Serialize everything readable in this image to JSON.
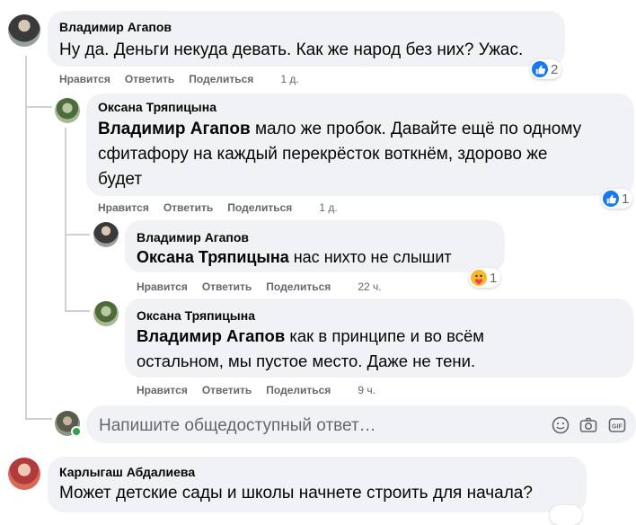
{
  "comments": [
    {
      "author": "Владимир Агапов",
      "mention": "",
      "text": "Ну да. Деньги некуда девать. Как же народ без них? Ужас.",
      "actions": {
        "like": "Нравится",
        "reply": "Ответить",
        "share": "Поделиться",
        "time": "1 д."
      },
      "reaction_count": "2"
    },
    {
      "author": "Оксана Тряпицына",
      "mention": "Владимир Агапов",
      "text_line1": " мало же пробок. Давайте ещё по одному",
      "text_line2": "сфитафору на каждый перекрёсток воткнём, здорово же",
      "text_line3": "будет",
      "actions": {
        "like": "Нравится",
        "reply": "Ответить",
        "share": "Поделиться",
        "time": "1 д."
      },
      "reaction_count": "1"
    },
    {
      "author": "Владимир Агапов",
      "mention": "Оксана Тряпицына",
      "text": " нас нихто не слышит",
      "actions": {
        "like": "Нравится",
        "reply": "Ответить",
        "share": "Поделиться",
        "time": "22 ч."
      },
      "reaction_count": "1"
    },
    {
      "author": "Оксана Тряпицына",
      "mention": "Владимир Агапов",
      "text_line1": " как в принципе и во всём",
      "text_line2": "остальном, мы пустое место. Даже не тени.",
      "actions": {
        "like": "Нравится",
        "reply": "Ответить",
        "share": "Поделиться",
        "time": "9 ч."
      }
    },
    {
      "author": "Карлыгаш Абдалиева",
      "text": "Может детские сады и школы начнете строить для начала?"
    }
  ],
  "reply": {
    "placeholder": "Напишите общедоступный ответ…",
    "icons": [
      "emoji-icon",
      "camera-icon",
      "gif-icon"
    ]
  },
  "colors": {
    "bubble": "#f0f2f5",
    "like_blue": "#1877f2",
    "meta_gray": "#65676b",
    "thread_line": "#ced0d4"
  }
}
